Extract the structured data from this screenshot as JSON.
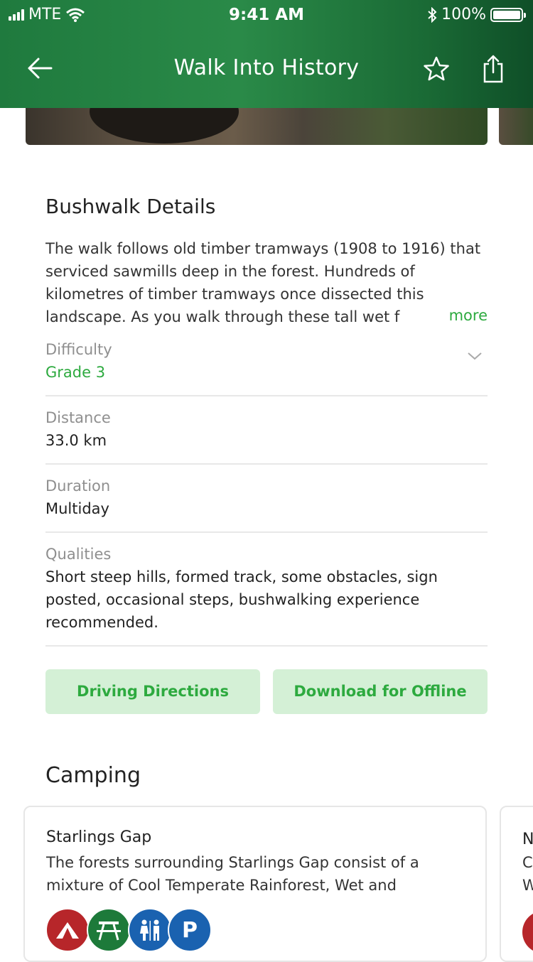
{
  "status_bar": {
    "carrier": "MTE",
    "time": "9:41 AM",
    "battery": "100%"
  },
  "nav": {
    "title": "Walk Into History"
  },
  "bushwalk": {
    "heading": "Bushwalk Details",
    "description": "The walk follows old timber tramways (1908 to 1916) that serviced sawmills deep in the forest. Hundreds of kilometres of timber tramways once dissected this landscape. As you walk through these tall wet f",
    "more_label": "more",
    "details": [
      {
        "label": "Difficulty",
        "value": "Grade 3"
      },
      {
        "label": "Distance",
        "value": "33.0 km"
      },
      {
        "label": "Duration",
        "value": "Multiday"
      },
      {
        "label": "Qualities",
        "value": "Short steep hills, formed track, some obstacles, sign posted, occasional steps, bushwalking experience recommended."
      }
    ],
    "buttons": {
      "driving": "Driving Directions",
      "download": "Download for Offline"
    }
  },
  "camping": {
    "heading": "Camping",
    "cards": [
      {
        "title": "Starlings Gap",
        "text": "The forests surrounding Starlings Gap consist of a mixture of Cool Temperate Rainforest, Wet and",
        "facilities": [
          "camping-icon",
          "picnic-table-icon",
          "toilets-icon",
          "parking-icon"
        ],
        "parking_letter": "P"
      },
      {
        "title": "N",
        "text": "C",
        "text2": "W"
      }
    ]
  },
  "colors": {
    "accent": "#2daa3f",
    "header": "#1f7a3e",
    "button_bg": "#d4f0d6",
    "camping_red": "#b7262a",
    "picnic_green": "#1d7a3a",
    "toilet_blue": "#1a62b0",
    "parking_blue": "#1a62b0"
  }
}
